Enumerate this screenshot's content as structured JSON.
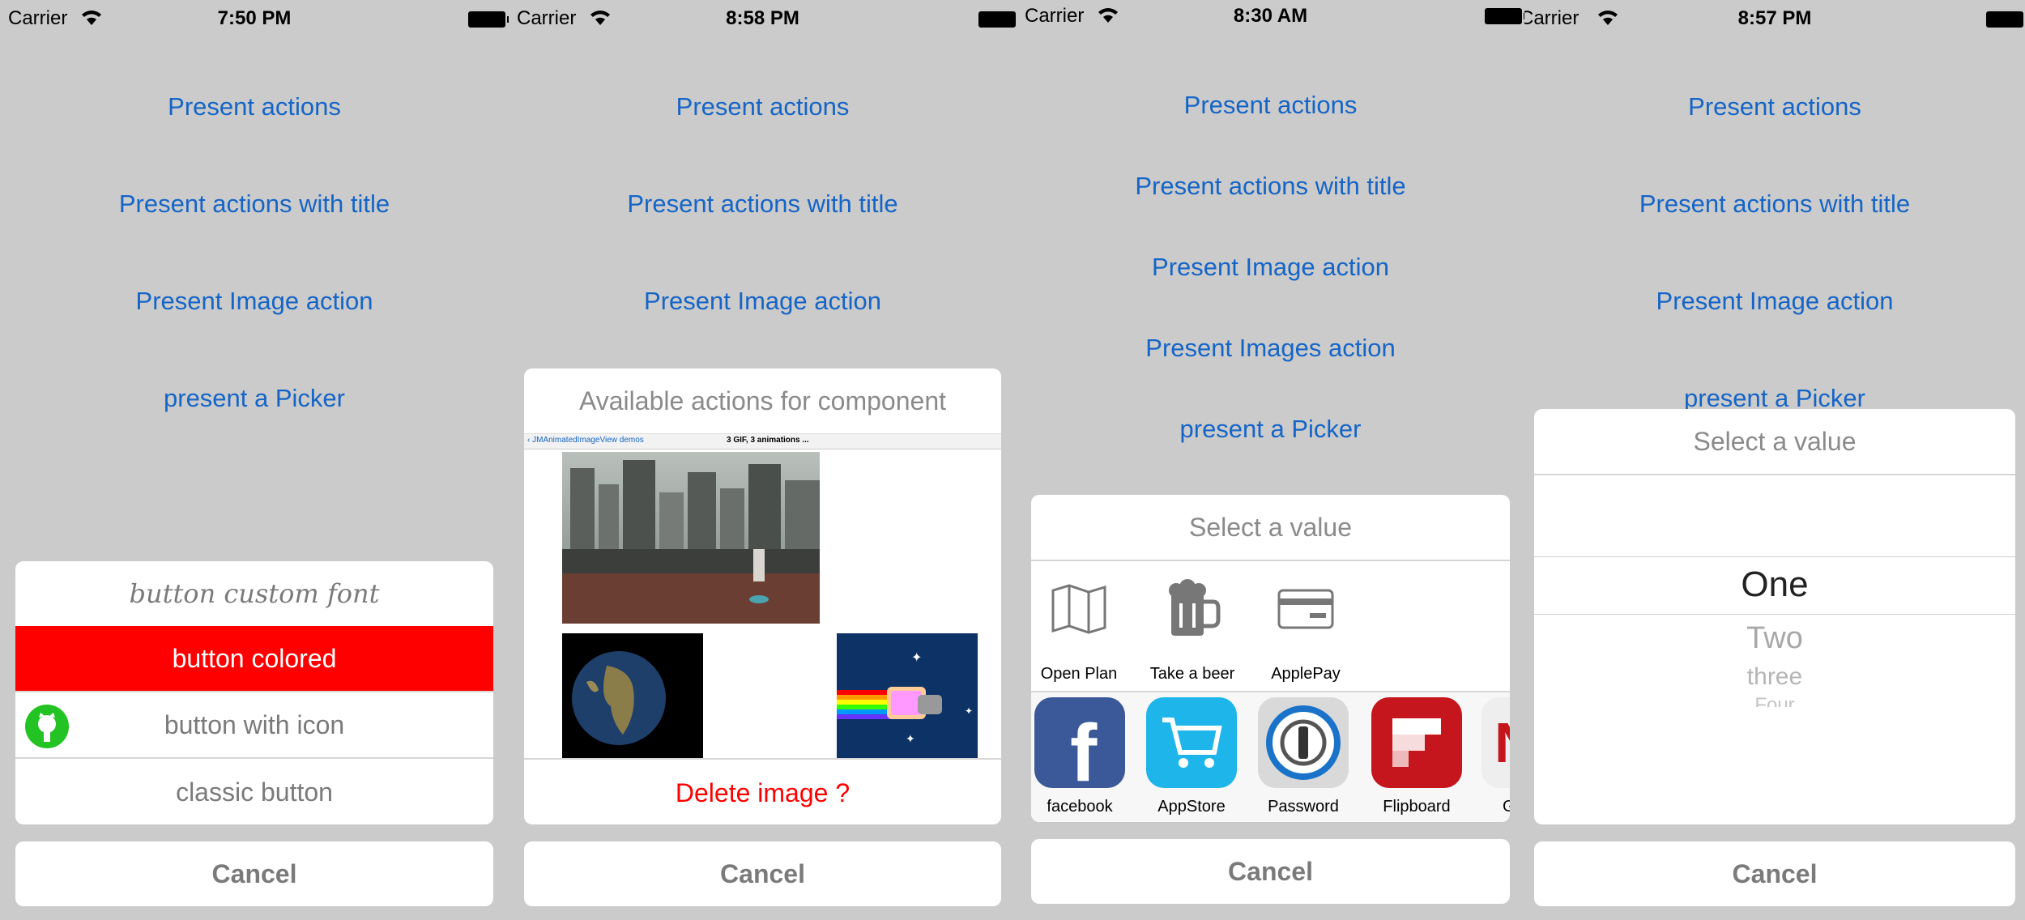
{
  "screens": [
    {
      "status": {
        "carrier": "Carrier",
        "time": "7:50 PM"
      },
      "links": [
        "Present actions",
        "Present actions with title",
        "Present Image action",
        "present a Picker"
      ],
      "sheet": {
        "custom_font": "button custom font",
        "colored": "button colored",
        "with_icon": "button with icon",
        "classic": "classic button"
      },
      "cancel": "Cancel"
    },
    {
      "status": {
        "carrier": "Carrier",
        "time": "8:58 PM"
      },
      "links": [
        "Present actions",
        "Present actions with title",
        "Present Image action"
      ],
      "sheet": {
        "title": "Available actions for component",
        "nav_back": "JMAnimatedImageView demos",
        "nav_title": "3 GIF, 3 animations ...",
        "delete": "Delete image ?"
      },
      "cancel": "Cancel"
    },
    {
      "status": {
        "carrier": "Carrier",
        "time": "8:30 AM"
      },
      "links": [
        "Present actions",
        "Present actions with title",
        "Present Image action",
        "Present Images action",
        "present a Picker"
      ],
      "sheet": {
        "title": "Select a value",
        "actions": [
          "Open Plan",
          "Take a beer",
          "ApplePay"
        ],
        "apps": [
          "facebook",
          "AppStore",
          "Password",
          "Flipboard",
          "G"
        ]
      },
      "cancel": "Cancel"
    },
    {
      "status": {
        "carrier": "Carrier",
        "time": "8:57 PM"
      },
      "links": [
        "Present actions",
        "Present actions with title",
        "Present Image action",
        "present a Picker"
      ],
      "sheet": {
        "title": "Select a value",
        "picker": [
          "One",
          "Two",
          "three",
          "Four"
        ]
      },
      "cancel": "Cancel"
    }
  ],
  "colors": {
    "link": "#1565c7",
    "destructive": "#ff0000",
    "background": "#cbcbcb"
  }
}
